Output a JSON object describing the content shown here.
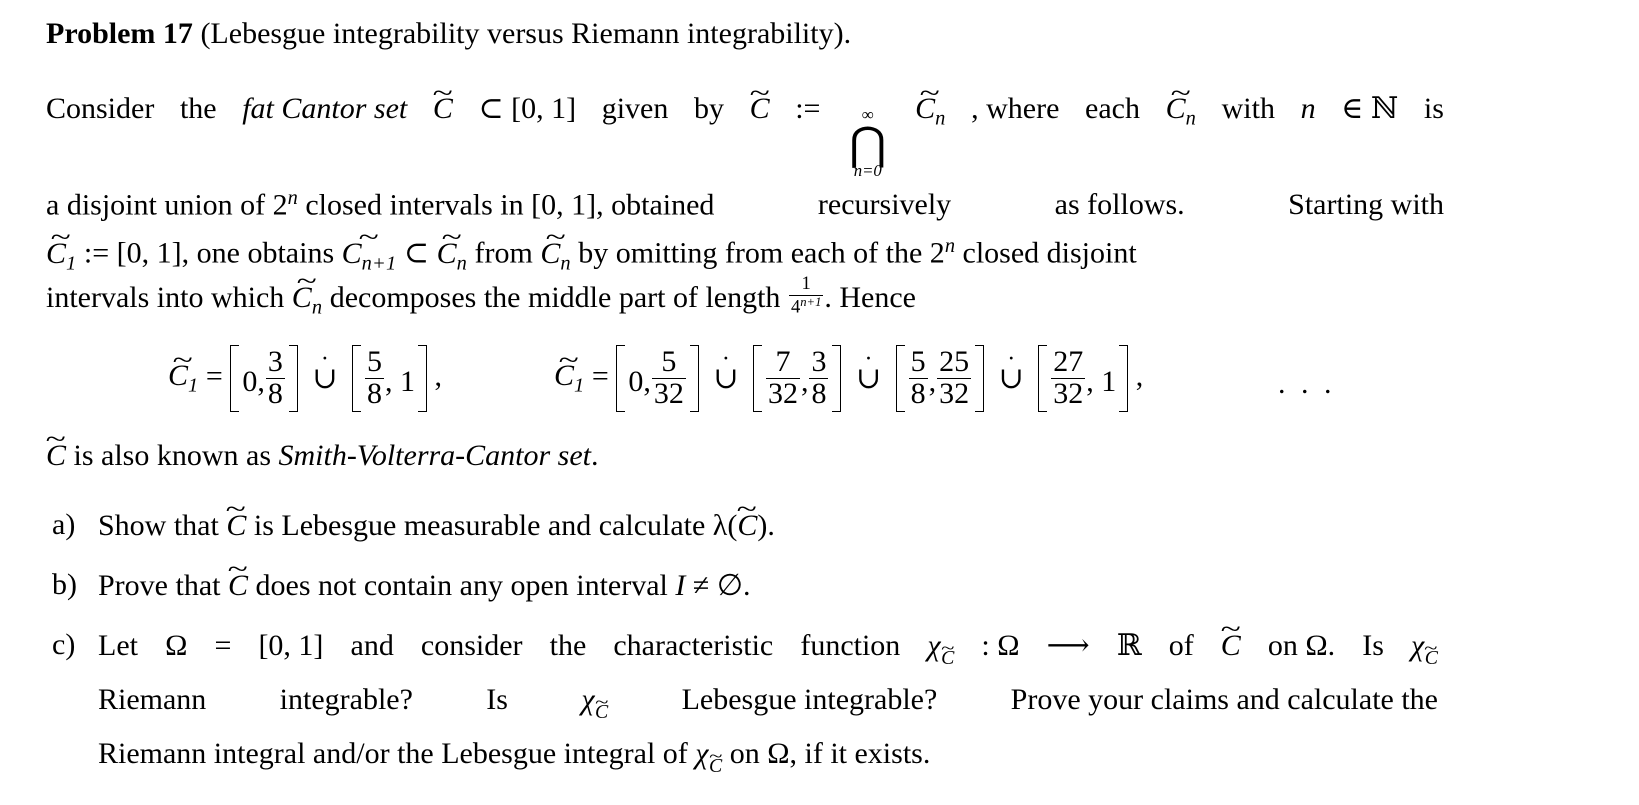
{
  "document": {
    "problem_label": "Problem 17",
    "problem_title": "(Lebesgue integrability versus Riemann integrability).",
    "intro": {
      "l1_a": "Consider",
      "l1_b": "the",
      "l1_c": "fat Cantor set",
      "l1_d": "⊂ [0, 1]",
      "l1_e": "given",
      "l1_f": "by",
      "l1_g": ":=",
      "l1_h": "∞",
      "l1_i": "⋂",
      "l1_j": "n=0",
      "l1_k": ", where",
      "l1_l": "each",
      "l1_m": "with",
      "l1_n": "n",
      "l1_o": "∈ ℕ",
      "l1_p": "is",
      "l2_a": "a disjoint union of 2",
      "l2_b": "n",
      "l2_c": " closed intervals in [0, 1], obtained",
      "l2_d": "recursively",
      "l2_e": "as follows.",
      "l2_f": "Starting with",
      "l3_a": ":= [0, 1], one obtains",
      "l3_b": "n+1",
      "l3_c": "⊂",
      "l3_d": "n",
      "l3_e": "from",
      "l3_f": "n",
      "l3_g": "by omitting from each of the 2",
      "l3_h": "n",
      "l3_i": " closed disjoint",
      "l4_a": "intervals into which",
      "l4_b": "n",
      "l4_c": "decomposes the middle part of length",
      "l4_d": "1",
      "l4_e": "4",
      "l4_f": "n+1",
      "l4_g": ". Hence"
    },
    "equations": {
      "eq1": {
        "lhs_symbol": "C",
        "lhs_sub": "1",
        "equals": "=",
        "i1_left": "0,",
        "i1_num": "3",
        "i1_den": "8",
        "union": "∪",
        "union_dot": "·",
        "i2_num": "5",
        "i2_den": "8",
        "i2_right": ", 1",
        "trailing": ","
      },
      "eq2": {
        "lhs_symbol": "C",
        "lhs_sub": "1",
        "equals": "=",
        "i1_left": "0,",
        "i1_num": "5",
        "i1_den": "32",
        "u1": "∪",
        "u1_dot": "·",
        "i2_a_num": "7",
        "i2_a_den": "32",
        "i2_comma": ",",
        "i2_b_num": "3",
        "i2_b_den": "8",
        "u2": "∪",
        "u2_dot": "·",
        "i3_a_num": "5",
        "i3_a_den": "8",
        "i3_comma": ",",
        "i3_b_num": "25",
        "i3_b_den": "32",
        "u3": "∪",
        "u3_dot": "·",
        "i4_num": "27",
        "i4_den": "32",
        "i4_right": ", 1",
        "trailing": ","
      },
      "ellipsis": ". . ."
    },
    "alias_line": {
      "a": "is also known as",
      "b": "Smith-Volterra-Cantor set",
      "c": "."
    },
    "items": [
      {
        "mark": "a)",
        "l1_a": "Show that",
        "l1_b": "is Lebesgue measurable and calculate λ(",
        "l1_c": ")."
      },
      {
        "mark": "b)",
        "l1_a": "Prove that",
        "l1_b": "does not contain any open interval",
        "l1_c": "I",
        "l1_d": "≠ ∅."
      },
      {
        "mark": "c)",
        "l1_a": "Let",
        "l1_b": "Ω",
        "l1_c": "=",
        "l1_d": "[0, 1]",
        "l1_e": "and",
        "l1_f": "consider",
        "l1_g": "the",
        "l1_h": "characteristic",
        "l1_i": "function",
        "l1_j": "χ",
        "l1_k": ": Ω",
        "l1_l": "⟶",
        "l1_m": "ℝ",
        "l1_n": "of",
        "l1_o": "on Ω.",
        "l1_p": "Is",
        "l1_q": "χ",
        "l2_a": "Riemann",
        "l2_b": "integrable?",
        "l2_c": "Is",
        "l2_d": "χ",
        "l2_e": "Lebesgue integrable?",
        "l2_f": "Prove your claims and calculate the",
        "l3_a": "Riemann integral and/or the Lebesgue integral of",
        "l3_b": "χ",
        "l3_c": "on Ω, if it exists."
      }
    ],
    "symbols": {
      "tilde": "~",
      "C": "C",
      "intersection": "⋂",
      "subset": "⊂",
      "cup": "∪",
      "dot": "·"
    }
  }
}
